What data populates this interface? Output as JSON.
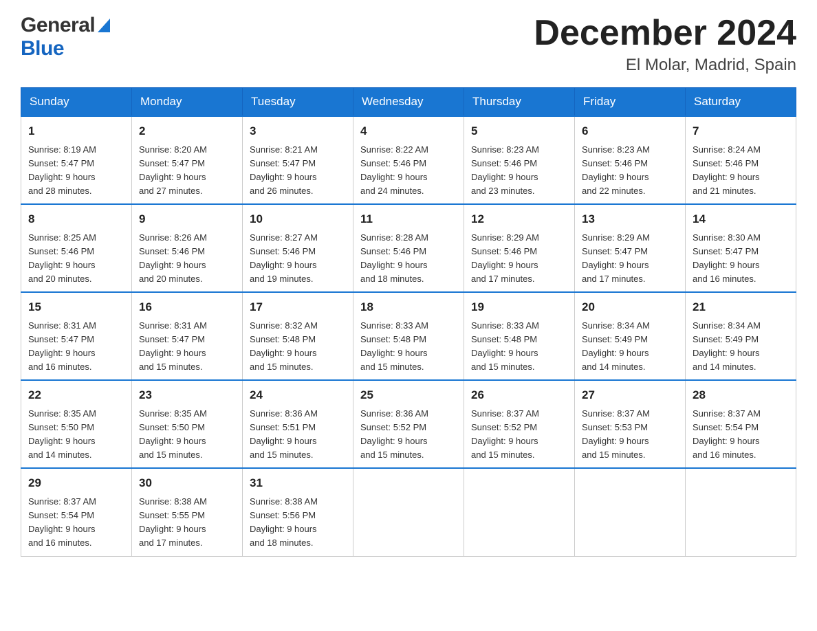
{
  "header": {
    "logo_general": "General",
    "logo_blue": "Blue",
    "month_title": "December 2024",
    "location": "El Molar, Madrid, Spain"
  },
  "days_of_week": [
    "Sunday",
    "Monday",
    "Tuesday",
    "Wednesday",
    "Thursday",
    "Friday",
    "Saturday"
  ],
  "weeks": [
    [
      {
        "day": "1",
        "sunrise": "8:19 AM",
        "sunset": "5:47 PM",
        "daylight": "9 hours and 28 minutes."
      },
      {
        "day": "2",
        "sunrise": "8:20 AM",
        "sunset": "5:47 PM",
        "daylight": "9 hours and 27 minutes."
      },
      {
        "day": "3",
        "sunrise": "8:21 AM",
        "sunset": "5:47 PM",
        "daylight": "9 hours and 26 minutes."
      },
      {
        "day": "4",
        "sunrise": "8:22 AM",
        "sunset": "5:46 PM",
        "daylight": "9 hours and 24 minutes."
      },
      {
        "day": "5",
        "sunrise": "8:23 AM",
        "sunset": "5:46 PM",
        "daylight": "9 hours and 23 minutes."
      },
      {
        "day": "6",
        "sunrise": "8:23 AM",
        "sunset": "5:46 PM",
        "daylight": "9 hours and 22 minutes."
      },
      {
        "day": "7",
        "sunrise": "8:24 AM",
        "sunset": "5:46 PM",
        "daylight": "9 hours and 21 minutes."
      }
    ],
    [
      {
        "day": "8",
        "sunrise": "8:25 AM",
        "sunset": "5:46 PM",
        "daylight": "9 hours and 20 minutes."
      },
      {
        "day": "9",
        "sunrise": "8:26 AM",
        "sunset": "5:46 PM",
        "daylight": "9 hours and 20 minutes."
      },
      {
        "day": "10",
        "sunrise": "8:27 AM",
        "sunset": "5:46 PM",
        "daylight": "9 hours and 19 minutes."
      },
      {
        "day": "11",
        "sunrise": "8:28 AM",
        "sunset": "5:46 PM",
        "daylight": "9 hours and 18 minutes."
      },
      {
        "day": "12",
        "sunrise": "8:29 AM",
        "sunset": "5:46 PM",
        "daylight": "9 hours and 17 minutes."
      },
      {
        "day": "13",
        "sunrise": "8:29 AM",
        "sunset": "5:47 PM",
        "daylight": "9 hours and 17 minutes."
      },
      {
        "day": "14",
        "sunrise": "8:30 AM",
        "sunset": "5:47 PM",
        "daylight": "9 hours and 16 minutes."
      }
    ],
    [
      {
        "day": "15",
        "sunrise": "8:31 AM",
        "sunset": "5:47 PM",
        "daylight": "9 hours and 16 minutes."
      },
      {
        "day": "16",
        "sunrise": "8:31 AM",
        "sunset": "5:47 PM",
        "daylight": "9 hours and 15 minutes."
      },
      {
        "day": "17",
        "sunrise": "8:32 AM",
        "sunset": "5:48 PM",
        "daylight": "9 hours and 15 minutes."
      },
      {
        "day": "18",
        "sunrise": "8:33 AM",
        "sunset": "5:48 PM",
        "daylight": "9 hours and 15 minutes."
      },
      {
        "day": "19",
        "sunrise": "8:33 AM",
        "sunset": "5:48 PM",
        "daylight": "9 hours and 15 minutes."
      },
      {
        "day": "20",
        "sunrise": "8:34 AM",
        "sunset": "5:49 PM",
        "daylight": "9 hours and 14 minutes."
      },
      {
        "day": "21",
        "sunrise": "8:34 AM",
        "sunset": "5:49 PM",
        "daylight": "9 hours and 14 minutes."
      }
    ],
    [
      {
        "day": "22",
        "sunrise": "8:35 AM",
        "sunset": "5:50 PM",
        "daylight": "9 hours and 14 minutes."
      },
      {
        "day": "23",
        "sunrise": "8:35 AM",
        "sunset": "5:50 PM",
        "daylight": "9 hours and 15 minutes."
      },
      {
        "day": "24",
        "sunrise": "8:36 AM",
        "sunset": "5:51 PM",
        "daylight": "9 hours and 15 minutes."
      },
      {
        "day": "25",
        "sunrise": "8:36 AM",
        "sunset": "5:52 PM",
        "daylight": "9 hours and 15 minutes."
      },
      {
        "day": "26",
        "sunrise": "8:37 AM",
        "sunset": "5:52 PM",
        "daylight": "9 hours and 15 minutes."
      },
      {
        "day": "27",
        "sunrise": "8:37 AM",
        "sunset": "5:53 PM",
        "daylight": "9 hours and 15 minutes."
      },
      {
        "day": "28",
        "sunrise": "8:37 AM",
        "sunset": "5:54 PM",
        "daylight": "9 hours and 16 minutes."
      }
    ],
    [
      {
        "day": "29",
        "sunrise": "8:37 AM",
        "sunset": "5:54 PM",
        "daylight": "9 hours and 16 minutes."
      },
      {
        "day": "30",
        "sunrise": "8:38 AM",
        "sunset": "5:55 PM",
        "daylight": "9 hours and 17 minutes."
      },
      {
        "day": "31",
        "sunrise": "8:38 AM",
        "sunset": "5:56 PM",
        "daylight": "9 hours and 18 minutes."
      },
      null,
      null,
      null,
      null
    ]
  ],
  "labels": {
    "sunrise": "Sunrise:",
    "sunset": "Sunset:",
    "daylight": "Daylight:"
  }
}
